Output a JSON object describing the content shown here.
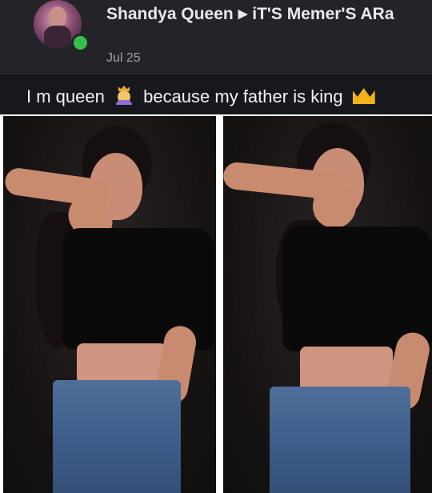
{
  "post": {
    "author": "Shandya Queen",
    "group": "iT'S Memer'S ARa",
    "timestamp": "Jul 25",
    "caption_part1": "I m queen",
    "caption_part2": "because my father is king"
  },
  "icons": {
    "arrow": "right-triangle-arrow",
    "emoji1": "woman-with-crown-emoji",
    "emoji2": "crown-emoji",
    "presence": "online-indicator"
  },
  "colors": {
    "header_bg": "#22242a",
    "caption_bg": "#17181c",
    "online": "#35c24a",
    "text": "#e8e9ec",
    "timestamp": "#9ea1a8"
  }
}
